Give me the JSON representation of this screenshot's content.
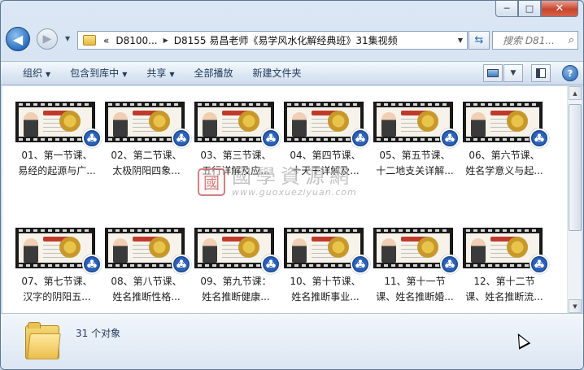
{
  "window": {
    "minimize_glyph": "─",
    "maximize_glyph": "□",
    "close_glyph": "✕"
  },
  "nav": {
    "back_icon": "back-arrow-icon",
    "forward_icon": "forward-arrow-icon",
    "breadcrumb_prefix": "«",
    "breadcrumb": [
      "D8100...",
      "D8155 易昌老师《易学风水化解经典班》31集视频"
    ],
    "search_placeholder": "搜索 D81..."
  },
  "toolbar": {
    "organize": "组织",
    "include_in_library": "包含到库中",
    "share": "共享",
    "play_all": "全部播放",
    "new_folder": "新建文件夹",
    "help_glyph": "?"
  },
  "files": [
    {
      "line1": "01、第一节课、",
      "line2": "易经的起源与广..."
    },
    {
      "line1": "02、第二节课、",
      "line2": "太极阴阳四象..."
    },
    {
      "line1": "03、第三节课、",
      "line2": "五行详解及应..."
    },
    {
      "line1": "04、第四节课、",
      "line2": "十天干详解及..."
    },
    {
      "line1": "05、第五节课、",
      "line2": "十二地支关详解..."
    },
    {
      "line1": "06、第六节课、",
      "line2": "姓名学意义与起..."
    },
    {
      "line1": "07、第七节课、",
      "line2": "汉字的阴阳五..."
    },
    {
      "line1": "08、第八节课、",
      "line2": "姓名推断性格..."
    },
    {
      "line1": "09、第九节课：",
      "line2": "姓名推断健康..."
    },
    {
      "line1": "10、第十节课、",
      "line2": "姓名推断事业..."
    },
    {
      "line1": "11、第十一节",
      "line2": "课、姓名推断婚..."
    },
    {
      "line1": "12、第十二节",
      "line2": "课、姓名推断流..."
    }
  ],
  "watermark": {
    "seal": "國",
    "text": "國學資源網",
    "url": "www.guoxueziyuan.com"
  },
  "details": {
    "object_count": "31 个对象"
  }
}
